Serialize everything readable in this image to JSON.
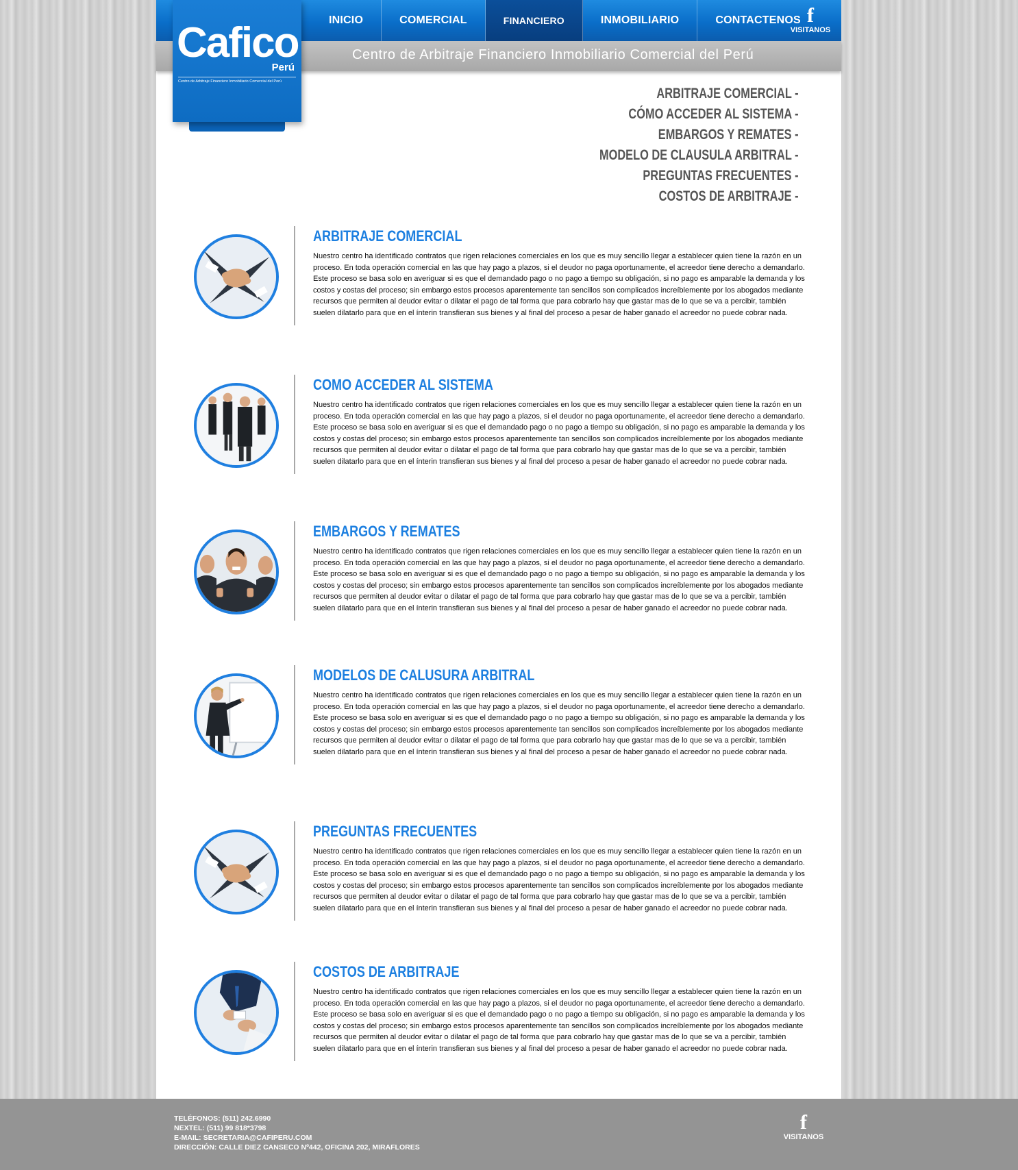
{
  "nav": {
    "items": [
      "INICIO",
      "COMERCIAL",
      "FINANCIERO",
      "INMOBILIARIO",
      "CONTACTENOS"
    ],
    "active": "FINANCIERO",
    "facebook_label": "VISITANOS"
  },
  "header": {
    "tagline": "Centro de Arbitraje Financiero Inmobiliario Comercial del Perú"
  },
  "logo": {
    "word": "Cafico",
    "sub": "Perú",
    "tiny": "Centro de Arbitraje Financiero Inmobiliario Comercial del Perú"
  },
  "quick_links": [
    "ARBITRAJE COMERCIAL -",
    "CÓMO ACCEDER AL SISTEMA -",
    "EMBARGOS Y REMATES -",
    "MODELO DE CLAUSULA ARBITRAL -",
    "PREGUNTAS FRECUENTES -",
    "COSTOS DE ARBITRAJE -"
  ],
  "sections": [
    {
      "title": "ARBITRAJE COMERCIAL",
      "image_icon": "team-hands-photo",
      "body": "Nuestro centro ha identificado contratos que rigen relaciones comerciales en los que es muy sencillo llegar a establecer quien tiene la razón en un proceso. En toda operación comercial en las que hay pago a plazos, si el deudor no paga oportunamente, el acreedor tiene derecho a demandarlo. Este proceso se basa solo en averiguar si es que el demandado pago o no pago a tiempo su obligación, si no pago es amparable la demanda y los costos y costas del proceso; sin embargo estos procesos aparentemente tan sencillos son complicados increíblemente por los abogados mediante recursos que permiten al deudor evitar o dilatar el pago de tal forma que para cobrarlo hay que gastar mas de lo que se va a percibir, también suelen dilatarlo para que en el ínterin transfieran sus bienes y al final del proceso a pesar de haber ganado el acreedor no puede cobrar nada."
    },
    {
      "title": "COMO ACCEDER AL SISTEMA",
      "image_icon": "business-people-photo",
      "body": "Nuestro centro ha identificado contratos que rigen relaciones comerciales en los que es muy sencillo llegar a establecer quien tiene la razón en un proceso. En toda operación comercial en las que hay pago a plazos, si el deudor no paga oportunamente, el acreedor tiene derecho a demandarlo. Este proceso se basa solo en averiguar si es que el demandado pago o no pago a tiempo su obligación, si no pago es amparable la demanda y los costos y costas del proceso; sin embargo estos procesos aparentemente tan sencillos son complicados increíblemente por los abogados mediante recursos que permiten al deudor evitar o dilatar el pago de tal forma que para cobrarlo hay que gastar mas de lo que se va a percibir, también suelen dilatarlo para que en el ínterin transfieran sus bienes y al final del proceso a pesar de haber ganado el acreedor no puede cobrar nada."
    },
    {
      "title": "EMBARGOS Y REMATES",
      "image_icon": "thumbs-up-team-photo",
      "body": "Nuestro centro ha identificado contratos que rigen relaciones comerciales en los que es muy sencillo llegar a establecer quien tiene la razón en un proceso. En toda operación comercial en las que hay pago a plazos, si el deudor no paga oportunamente, el acreedor tiene derecho a demandarlo. Este proceso se basa solo en averiguar si es que el demandado pago o no pago a tiempo su obligación, si no pago es amparable la demanda y los costos y costas del proceso; sin embargo estos procesos aparentemente tan sencillos son complicados increíblemente por los abogados mediante recursos que permiten al deudor evitar o dilatar el pago de tal forma que para cobrarlo hay que gastar mas de lo que se va a percibir, también suelen dilatarlo para que en el ínterin transfieran sus bienes y al final del proceso a pesar de haber ganado el acreedor no puede cobrar nada."
    },
    {
      "title": "MODELOS DE CALUSURA ARBITRAL",
      "image_icon": "presenter-whiteboard-photo",
      "body": "Nuestro centro ha identificado contratos que rigen relaciones comerciales en los que es muy sencillo llegar a establecer quien tiene la razón en un proceso. En toda operación comercial en las que hay pago a plazos, si el deudor no paga oportunamente, el acreedor tiene derecho a demandarlo. Este proceso se basa solo en averiguar si es que el demandado pago o no pago a tiempo su obligación, si no pago es amparable la demanda y los costos y costas del proceso; sin embargo estos procesos aparentemente tan sencillos son complicados increíblemente por los abogados mediante recursos que permiten al deudor evitar o dilatar el pago de tal forma que para cobrarlo hay que gastar mas de lo que se va a percibir, también suelen dilatarlo para que en el ínterin transfieran sus bienes y al final del proceso a pesar de haber ganado el acreedor no puede cobrar nada."
    },
    {
      "title": "PREGUNTAS FRECUENTES",
      "image_icon": "team-hands-photo",
      "body": "Nuestro centro ha identificado contratos que rigen relaciones comerciales en los que es muy sencillo llegar a establecer quien tiene la razón en un proceso. En toda operación comercial en las que hay pago a plazos, si el deudor no paga oportunamente, el acreedor tiene derecho a demandarlo. Este proceso se basa solo en averiguar si es que el demandado pago o no pago a tiempo su obligación, si no pago es amparable la demanda y los costos y costas del proceso; sin embargo estos procesos aparentemente tan sencillos son complicados increíblemente por los abogados mediante recursos que permiten al deudor evitar o dilatar el pago de tal forma que para cobrarlo hay que gastar mas de lo que se va a percibir, también suelen dilatarlo para que en el ínterin transfieran sus bienes y al final del proceso a pesar de haber ganado el acreedor no puede cobrar nada."
    },
    {
      "title": "COSTOS DE ARBITRAJE",
      "image_icon": "card-handover-photo",
      "body": "Nuestro centro ha identificado contratos que rigen relaciones comerciales en los que es muy sencillo llegar a establecer quien tiene la razón en un proceso. En toda operación comercial en las que hay pago a plazos, si el deudor no paga oportunamente, el acreedor tiene derecho a demandarlo. Este proceso se basa solo en averiguar si es que el demandado pago o no pago a tiempo su obligación, si no pago es amparable la demanda y los costos y costas del proceso; sin embargo estos procesos aparentemente tan sencillos son complicados increíblemente por los abogados mediante recursos que permiten al deudor evitar o dilatar el pago de tal forma que para cobrarlo hay que gastar mas de lo que se va a percibir, también suelen dilatarlo para que en el ínterin transfieran sus bienes y al final del proceso a pesar de haber ganado el acreedor no puede cobrar nada."
    }
  ],
  "footer": {
    "telefonos": "TELÉFONOS:  (511) 242.6990",
    "nextel": "NEXTEL: (511) 99 818*3798",
    "email": "E-MAIL: SECRETARIA@CAFIPERU.COM",
    "direccion": "DIRECCIÓN: CALLE DIEZ CANSECO Nº442, OFICINA 202, MIRAFLORES",
    "facebook_label": "VISITANOS"
  },
  "colors": {
    "brand_blue": "#1c7fe0",
    "nav_blue": "#0a6ec9",
    "nav_active": "#083e7f",
    "footer_gray": "#949494",
    "quick_link_gray": "#555555"
  }
}
